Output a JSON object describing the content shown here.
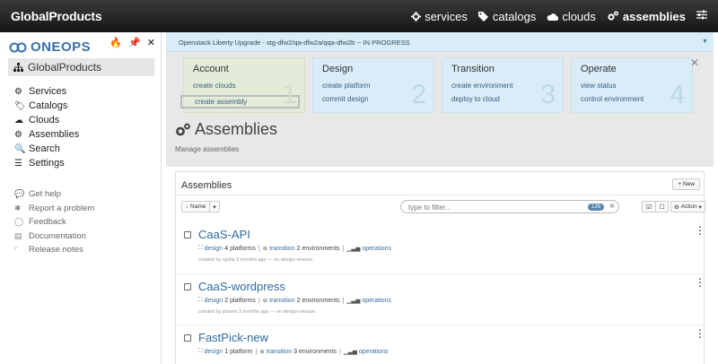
{
  "topbar": {
    "brand": "GlobalProducts",
    "nav": [
      {
        "icon": "gear-icon",
        "label": "services"
      },
      {
        "icon": "tags-icon",
        "label": "catalogs"
      },
      {
        "icon": "cloud-icon",
        "label": "clouds"
      },
      {
        "icon": "cogs-icon",
        "label": "assemblies"
      }
    ],
    "menu_icon": "sliders-icon"
  },
  "sidebar": {
    "logo": "ONEOPS",
    "org": "GlobalProducts",
    "tools": [
      "fire-icon",
      "pin-icon",
      "close-icon"
    ],
    "menu": [
      {
        "icon": "gear-icon",
        "glyph": "⚙",
        "label": "Services"
      },
      {
        "icon": "tags-icon",
        "glyph": "🏷",
        "label": "Catalogs"
      },
      {
        "icon": "cloud-icon",
        "glyph": "☁",
        "label": "Clouds"
      },
      {
        "icon": "cogs-icon",
        "glyph": "⚙",
        "label": "Assemblies"
      },
      {
        "icon": "search-icon",
        "glyph": "🔍",
        "label": "Search"
      },
      {
        "icon": "sliders-icon",
        "glyph": "☰",
        "label": "Settings"
      }
    ],
    "help": [
      {
        "icon": "comments-icon",
        "glyph": "💬",
        "label": "Get help"
      },
      {
        "icon": "bug-icon",
        "glyph": "✱",
        "label": "Report a problem"
      },
      {
        "icon": "comment-icon",
        "glyph": "◯",
        "label": "Feedback"
      },
      {
        "icon": "book-icon",
        "glyph": "▤",
        "label": "Documentation"
      },
      {
        "icon": "rss-icon",
        "glyph": "◜",
        "label": "Release notes"
      }
    ]
  },
  "notice": {
    "text": "Openstack Liberty Upgrade - stg-dfw2/qa-dfw2a/qqa-dfw2b -- IN PROGRESS"
  },
  "steps": [
    {
      "title": "Account",
      "num": "1",
      "links": [
        "create clouds",
        "create assembly"
      ]
    },
    {
      "title": "Design",
      "num": "2",
      "links": [
        "create platform",
        "commit design"
      ]
    },
    {
      "title": "Transition",
      "num": "3",
      "links": [
        "create environment",
        "deploy to cloud"
      ]
    },
    {
      "title": "Operate",
      "num": "4",
      "links": [
        "view status",
        "control environment"
      ]
    }
  ],
  "page": {
    "title": "Assemblies",
    "subtitle": "Manage assemblies"
  },
  "panel": {
    "title": "Assemblies",
    "new_label": "+ New",
    "sort_label": "↓ Name",
    "filter_placeholder": "type to filter...",
    "count": "126",
    "action_label": "Action"
  },
  "assemblies": [
    {
      "name": "CaaS-API",
      "design_count": "4",
      "design_unit": "platforms",
      "env_count": "2",
      "env_unit": "environments",
      "created": "created by rgolla 3 months ago — no design release"
    },
    {
      "name": "CaaS-wordpress",
      "design_count": "2",
      "design_unit": "platforms",
      "env_count": "2",
      "env_unit": "environments",
      "created": "created by jdoemi 3 months ago — no design release"
    },
    {
      "name": "FastPick-new",
      "design_count": "1",
      "design_unit": "platform",
      "env_count": "3",
      "env_unit": "environments",
      "created": ""
    }
  ],
  "labels": {
    "design": "design",
    "transition": "transition",
    "operations": "operations"
  }
}
